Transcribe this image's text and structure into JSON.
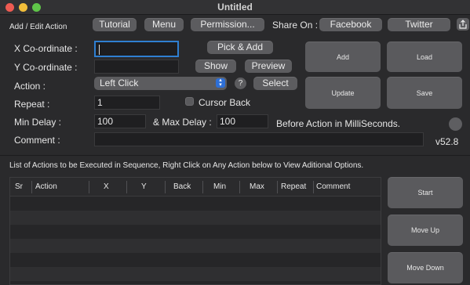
{
  "window": {
    "title": "Untitled"
  },
  "toolbar": {
    "tutorial": "Tutorial",
    "menu": "Menu",
    "permission": "Permission...",
    "share_on": "Share On :",
    "facebook": "Facebook",
    "twitter": "Twitter"
  },
  "section_label": "Add / Edit Action",
  "form": {
    "x_label": "X Co-ordinate :",
    "x_value": "",
    "y_label": "Y Co-ordinate :",
    "y_value": "",
    "pick_add": "Pick & Add",
    "show": "Show",
    "preview": "Preview",
    "action_label": "Action :",
    "action_value": "Left Click",
    "help": "?",
    "select": "Select",
    "repeat_label": "Repeat :",
    "repeat_value": "1",
    "cursor_back": "Cursor Back",
    "min_delay_label": "Min Delay :",
    "min_delay_value": "100",
    "max_delay_label": "& Max Delay :",
    "max_delay_value": "100",
    "delay_units": "Before Action in MilliSeconds.",
    "comment_label": "Comment :",
    "comment_value": "",
    "version": "v52.8"
  },
  "actions": {
    "add": "Add",
    "load": "Load",
    "update": "Update",
    "save": "Save"
  },
  "list_caption": "List of Actions to be Executed in Sequence, Right Click on Any Action below to View Aditional Options.",
  "table": {
    "columns": [
      "Sr",
      "Action",
      "X",
      "Y",
      "Back",
      "Min",
      "Max",
      "Repeat",
      "Comment"
    ]
  },
  "side_buttons": {
    "start": "Start",
    "move_up": "Move Up",
    "move_down": "Move Down"
  },
  "colors": {
    "accent": "#2f7fd1",
    "button": "#5c5c5f",
    "background": "#2a2a2c"
  }
}
